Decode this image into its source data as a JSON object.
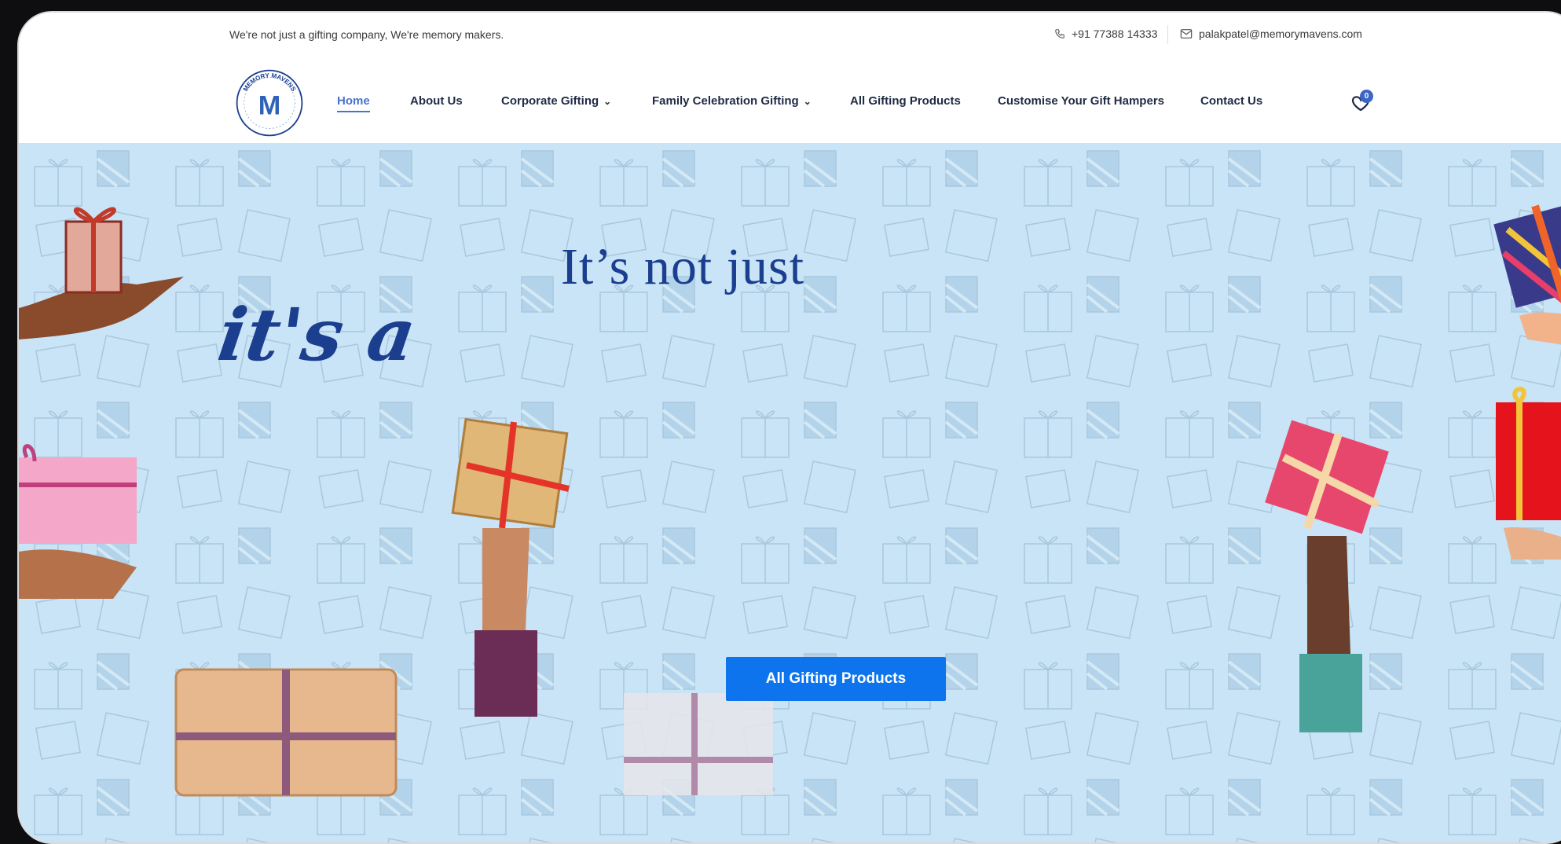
{
  "topbar": {
    "tagline": "We're not just a gifting company, We're memory makers.",
    "phone": "+91 77388 14333",
    "email": "palakpatel@memorymavens.com",
    "phone_icon": "phone-icon",
    "email_icon": "mail-icon"
  },
  "brand": {
    "logo_text": "MEMORY MAVENS",
    "monogram": "M"
  },
  "nav": {
    "items": [
      {
        "label": "Home",
        "active": true
      },
      {
        "label": "About Us"
      },
      {
        "label": "Corporate Gifting",
        "dropdown": true
      },
      {
        "label": "Family Celebration Gifting",
        "dropdown": true
      },
      {
        "label": "All Gifting Products"
      },
      {
        "label": "Customise Your Gift Hampers"
      },
      {
        "label": "Contact Us"
      }
    ],
    "dropdown_glyph": "⌄",
    "cart_count": "0",
    "cart_icon": "heart-bag-icon"
  },
  "hero": {
    "headline": "It’s not just",
    "script": "it's a",
    "cta_label": "All Gifting Products"
  },
  "colors": {
    "accent": "#4a72c8",
    "navy": "#1c3e8f",
    "cta": "#0d74ee",
    "hero_bg": "#c8e4f6"
  }
}
